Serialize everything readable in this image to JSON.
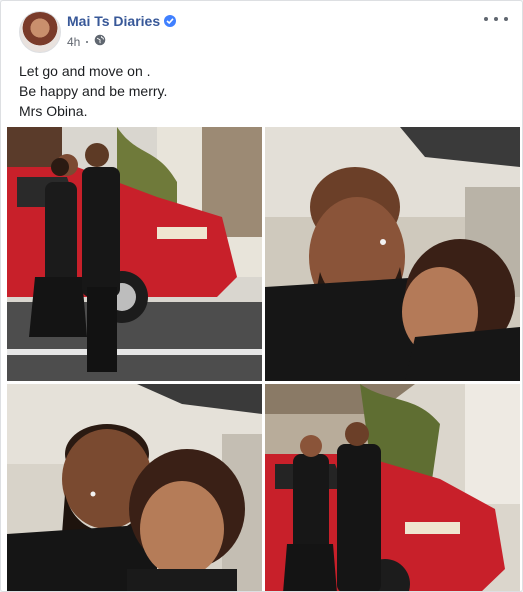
{
  "post": {
    "author": "Mai Ts Diaries",
    "time": "4h",
    "audience_icon": "globe-icon",
    "verified_icon": "verified-badge-icon",
    "more_icon": "more-options-icon",
    "text_lines": [
      "Let go and move on .",
      "Be happy and be merry.",
      "Mrs Obina."
    ],
    "photos": [
      {
        "name": "couple-kissing-by-car"
      },
      {
        "name": "couple-closeup-kiss"
      },
      {
        "name": "couple-selfie"
      },
      {
        "name": "couple-standing-by-car"
      }
    ]
  },
  "colors": {
    "author": "#385898",
    "text": "#1c1e21",
    "meta": "#616770",
    "verified": "#4080ff",
    "car": "#c8202a"
  }
}
